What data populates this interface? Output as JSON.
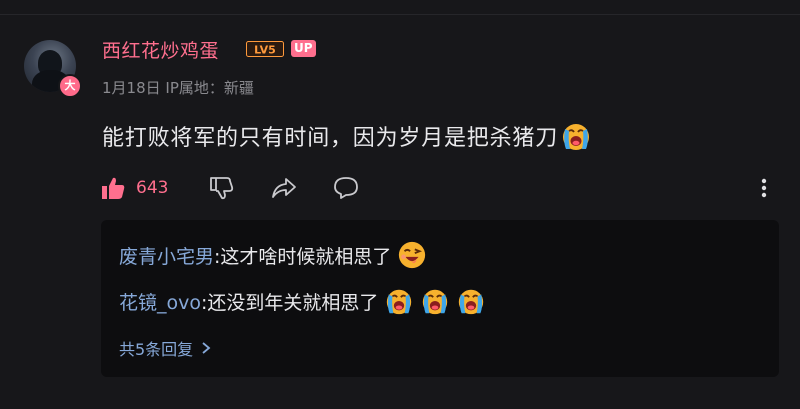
{
  "comment": {
    "avatar_badge": "大",
    "username": "西红花炒鸡蛋",
    "level": "LV5",
    "up_badge": "UP",
    "meta": "1月18日 IP属地：新疆",
    "text": "能打败将军的只有时间，因为岁月是把杀猪刀",
    "emoji_name": "crying-emoji",
    "likes": "643"
  },
  "replies": [
    {
      "author": "废青小宅男",
      "text": ":这才啥时候就相思了",
      "emojis": [
        "drooling-emoji"
      ]
    },
    {
      "author": "花镜_ovo",
      "text": ":还没到年关就相思了",
      "emojis": [
        "crying-emoji",
        "crying-emoji",
        "crying-emoji"
      ]
    }
  ],
  "more_replies": "共5条回复",
  "colors": {
    "accent": "#ff6f8e",
    "link": "#86a8d8",
    "background": "#17171a",
    "reply_background": "#0d0d0f"
  }
}
